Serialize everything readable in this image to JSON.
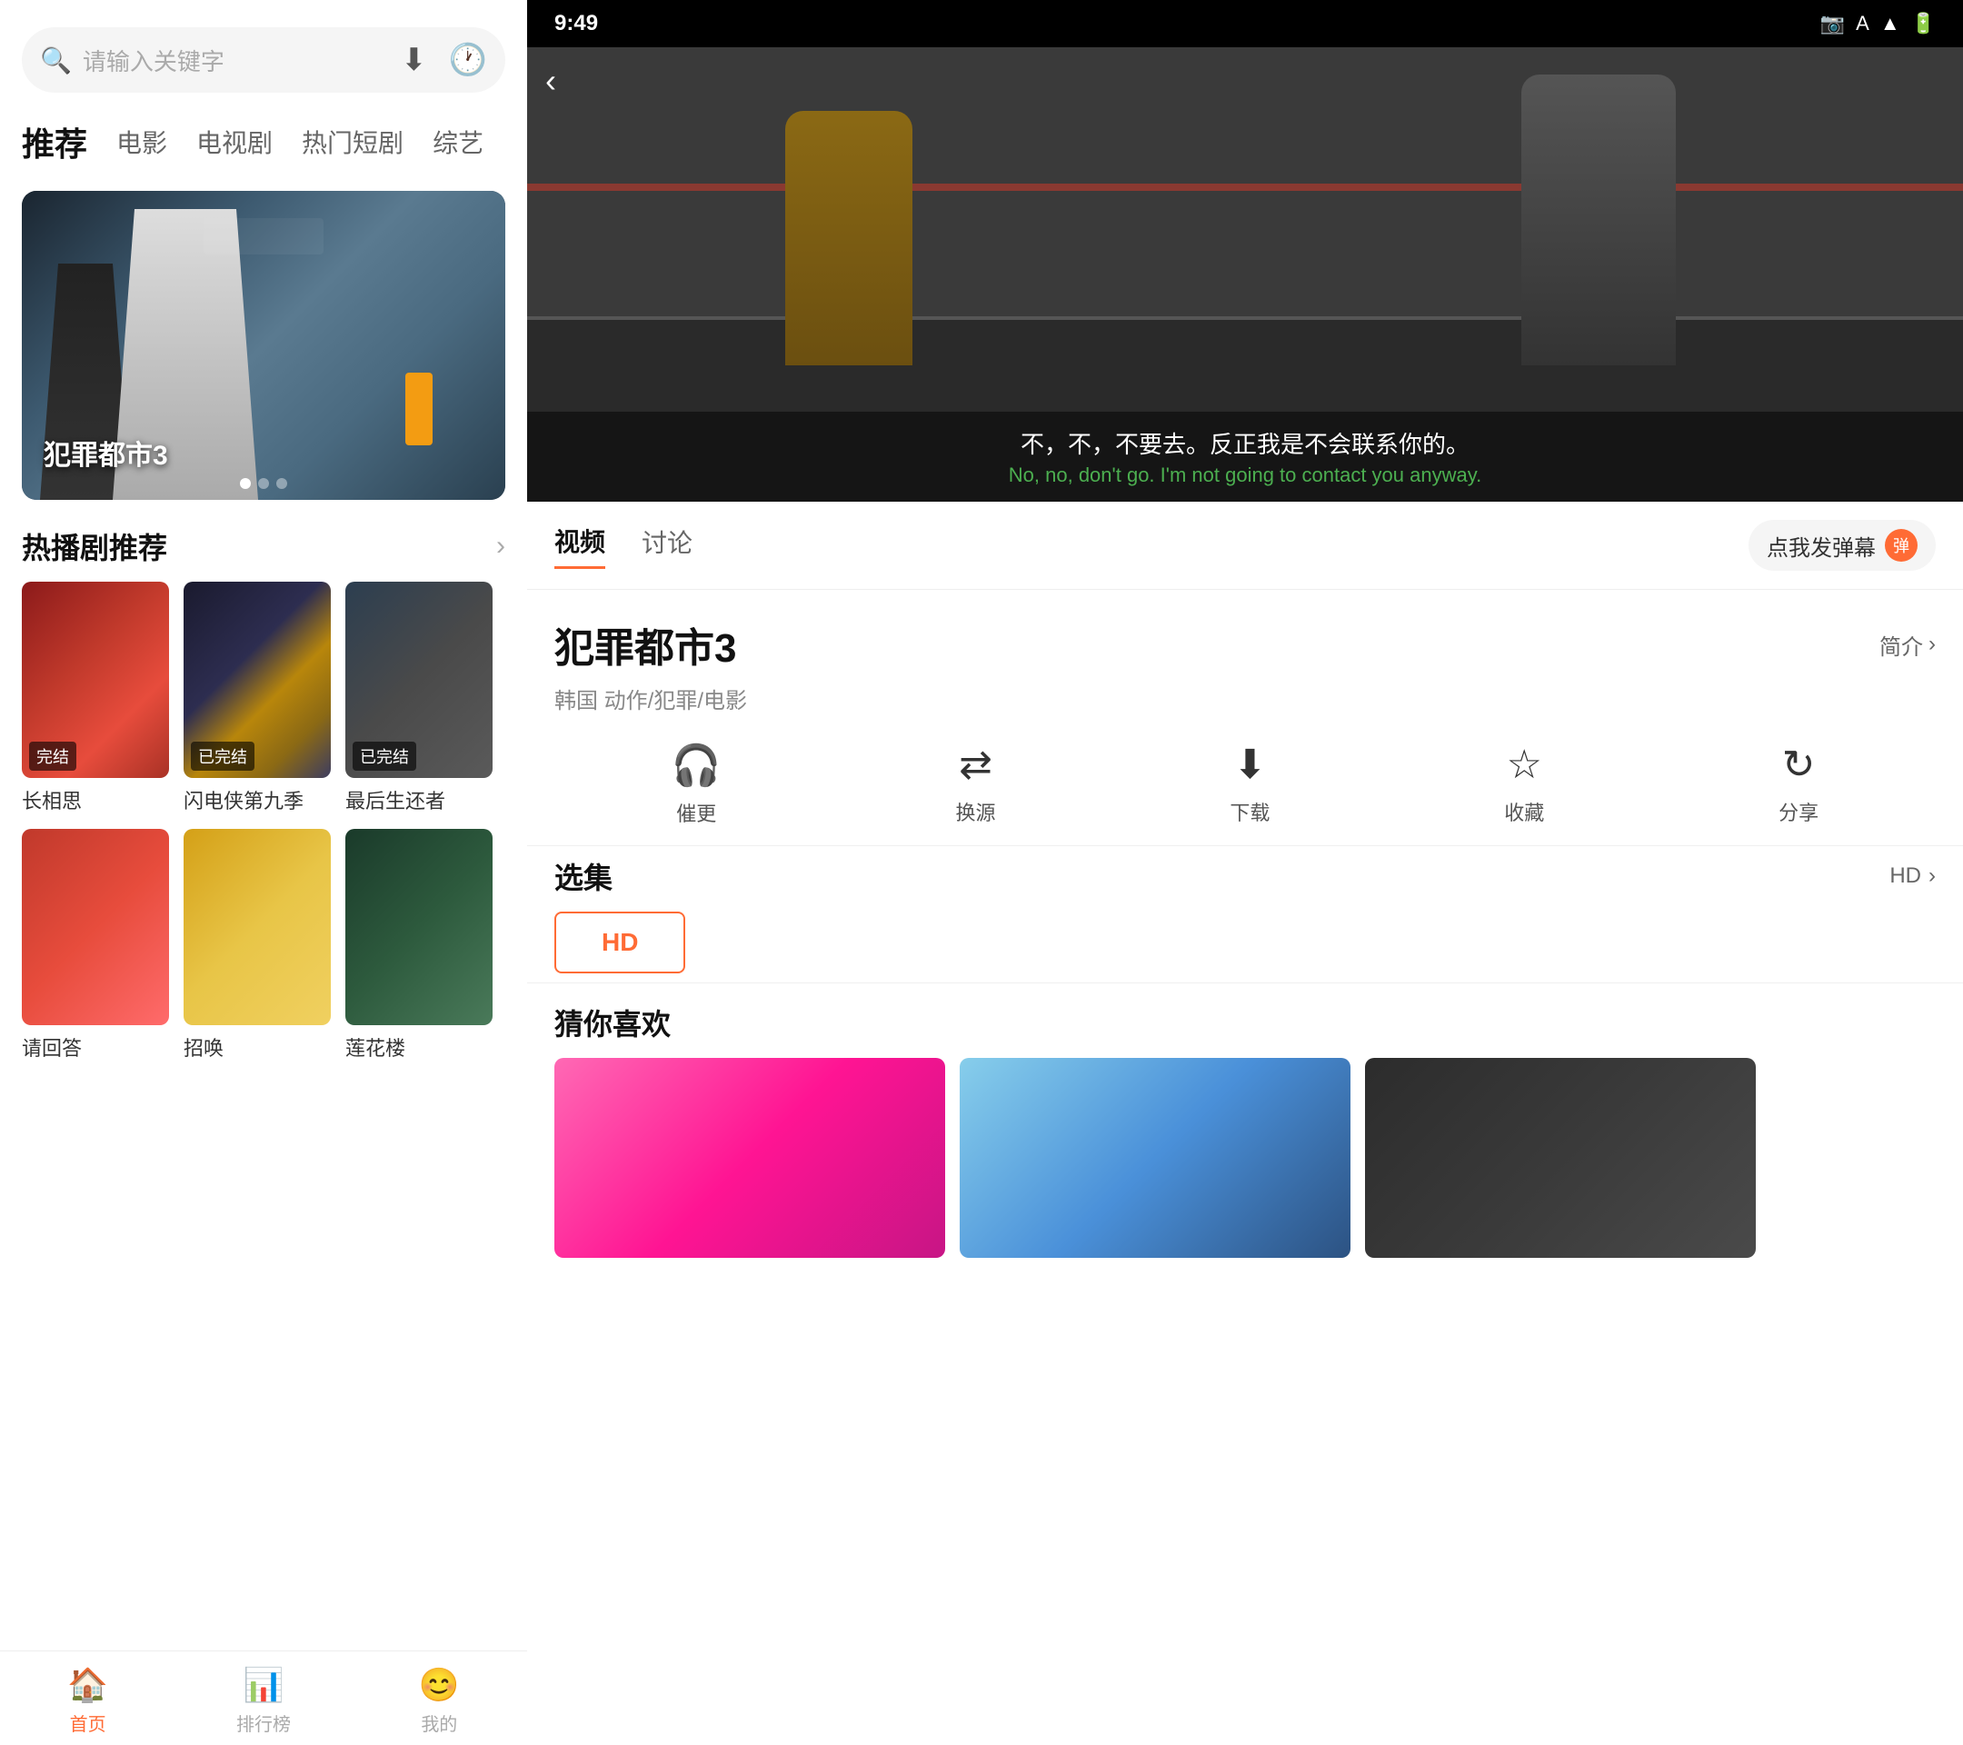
{
  "left": {
    "search": {
      "placeholder": "请输入关键字",
      "download_icon": "⬇",
      "history_icon": "🕐"
    },
    "nav_tabs": [
      {
        "label": "推荐",
        "active": true
      },
      {
        "label": "电影"
      },
      {
        "label": "电视剧"
      },
      {
        "label": "热门短剧"
      },
      {
        "label": "综艺"
      }
    ],
    "hero": {
      "title": "犯罪都市3"
    },
    "hot_section": {
      "title": "热播剧推荐"
    },
    "dramas": [
      {
        "title": "长相思",
        "badge": "完结",
        "bg": "bg-changxiangsi"
      },
      {
        "title": "闪电侠第九季",
        "badge": "已完结",
        "bg": "bg-flash"
      },
      {
        "title": "最后生还者",
        "badge": "已完结",
        "bg": "bg-lastofus"
      },
      {
        "title": "请回答",
        "badge": "",
        "bg": "bg-qinghuida"
      },
      {
        "title": "招唤",
        "badge": "",
        "bg": "bg-zhaohuan"
      },
      {
        "title": "莲花楼",
        "badge": "",
        "bg": "bg-lotus"
      }
    ],
    "bottom_nav": [
      {
        "label": "首页",
        "icon": "🏠",
        "active": true
      },
      {
        "label": "排行榜",
        "icon": "📊",
        "active": false
      },
      {
        "label": "我的",
        "icon": "😊",
        "active": false
      }
    ]
  },
  "right": {
    "status_bar": {
      "time": "9:49",
      "icons": [
        "📷",
        "A",
        "▲",
        "🔋"
      ]
    },
    "video": {
      "subtitle_cn": "不，不，不要去。反正我是不会联系你的。",
      "subtitle_en": "No, no, don't go. I'm not going to contact you anyway."
    },
    "back_btn": "‹",
    "tabs": [
      {
        "label": "视频",
        "active": true
      },
      {
        "label": "讨论",
        "active": false
      }
    ],
    "danmu_btn_label": "点我发弹幕",
    "danmu_badge": "弹",
    "movie": {
      "title": "犯罪都市3",
      "intro_label": "简介",
      "tags": "韩国 动作/犯罪/电影"
    },
    "action_buttons": [
      {
        "icon": "🎧",
        "label": "催更"
      },
      {
        "icon": "⇄",
        "label": "换源"
      },
      {
        "icon": "⬇",
        "label": "下载"
      },
      {
        "icon": "☆",
        "label": "收藏"
      },
      {
        "icon": "↻",
        "label": "分享"
      }
    ],
    "episodes": {
      "title": "选集",
      "hd_label": "HD",
      "arrow": "›",
      "chips": [
        "HD"
      ]
    },
    "recommendations": {
      "title": "猜你喜欢",
      "items": [
        {
          "bg": "rec-bg-1"
        },
        {
          "bg": "rec-bg-2"
        },
        {
          "bg": "rec-bg-3"
        }
      ]
    }
  }
}
